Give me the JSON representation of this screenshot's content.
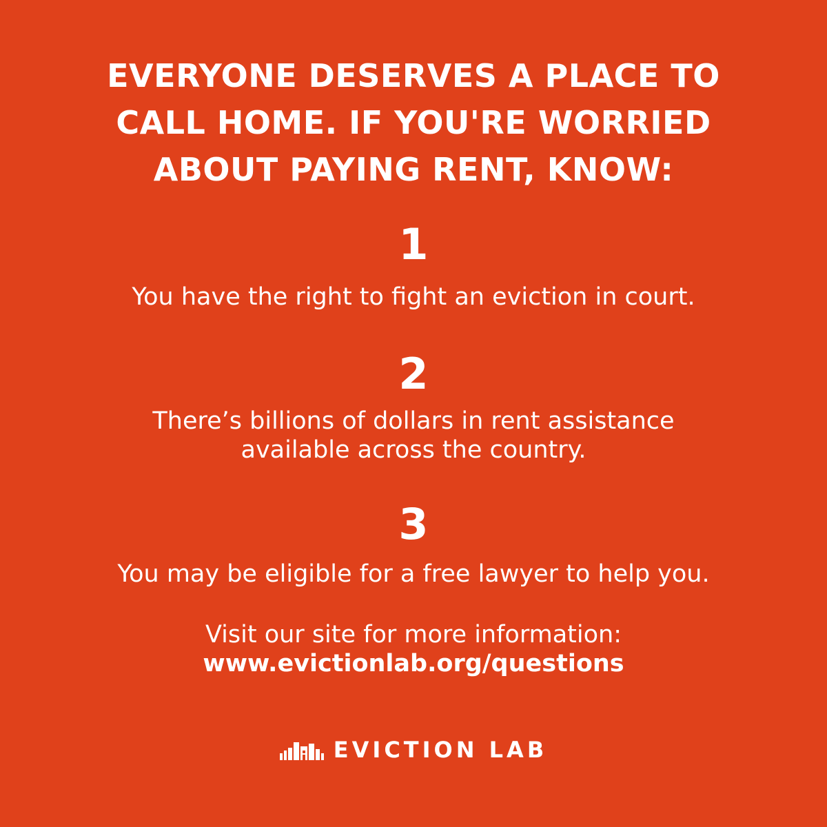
{
  "headline": {
    "line1": "EVERYONE DESERVES A PLACE TO",
    "line2": "CALL HOME. IF YOU'RE WORRIED",
    "line3": "ABOUT PAYING RENT, KNOW:"
  },
  "points": [
    {
      "number": "1",
      "lines": [
        "You have the right to fight an eviction in court."
      ]
    },
    {
      "number": "2",
      "lines": [
        "There’s billions of dollars in rent assistance",
        "available across the country."
      ]
    },
    {
      "number": "3",
      "lines": [
        "You may be eligible for a free lawyer to help you."
      ]
    }
  ],
  "footer": {
    "visit_text": "Visit our site for more information:",
    "url": "www.evictionlab.org/questions"
  },
  "logo": {
    "text": "EVICTION LAB",
    "icon": "buildings-icon"
  },
  "colors": {
    "background": "#e0411b",
    "text": "#ffffff"
  }
}
